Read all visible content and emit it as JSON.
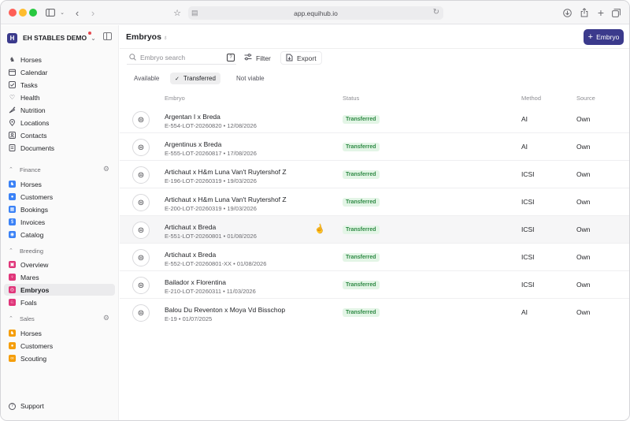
{
  "browser": {
    "url": "app.equihub.io"
  },
  "sidebar": {
    "org_name": "EH STABLES DEMO",
    "org_logo": "H",
    "main_items": [
      {
        "label": "Horses",
        "icon": "horse-icon"
      },
      {
        "label": "Calendar",
        "icon": "calendar-icon"
      },
      {
        "label": "Tasks",
        "icon": "tasks-icon"
      },
      {
        "label": "Health",
        "icon": "heart-icon"
      },
      {
        "label": "Nutrition",
        "icon": "carrot-icon"
      },
      {
        "label": "Locations",
        "icon": "location-icon"
      },
      {
        "label": "Contacts",
        "icon": "contacts-icon"
      },
      {
        "label": "Documents",
        "icon": "document-icon"
      }
    ],
    "finance": {
      "title": "Finance",
      "items": [
        {
          "label": "Horses"
        },
        {
          "label": "Customers"
        },
        {
          "label": "Bookings"
        },
        {
          "label": "Invoices"
        },
        {
          "label": "Catalog"
        }
      ]
    },
    "breeding": {
      "title": "Breeding",
      "items": [
        {
          "label": "Overview"
        },
        {
          "label": "Mares"
        },
        {
          "label": "Embryos"
        },
        {
          "label": "Foals"
        }
      ]
    },
    "sales": {
      "title": "Sales",
      "items": [
        {
          "label": "Horses"
        },
        {
          "label": "Customers"
        },
        {
          "label": "Scouting"
        }
      ]
    },
    "support_label": "Support"
  },
  "page": {
    "title": "Embryos",
    "primary_button": "Embryo",
    "search_placeholder": "Embryo search",
    "search_shortcut": "?",
    "filter_label": "Filter",
    "export_label": "Export",
    "tabs": [
      "Available",
      "Transferred",
      "Not viable"
    ],
    "active_tab": "Transferred"
  },
  "table": {
    "headers": {
      "embryo": "Embryo",
      "status": "Status",
      "method": "Method",
      "source": "Source"
    },
    "rows": [
      {
        "name": "Argentan I  x  Breda",
        "sub": "E-554-LOT-20260820 • 12/08/2026",
        "status": "Transferred",
        "method": "AI",
        "source": "Own"
      },
      {
        "name": "Argentinus  x  Breda",
        "sub": "E-555-LOT-20260817 • 17/08/2026",
        "status": "Transferred",
        "method": "AI",
        "source": "Own"
      },
      {
        "name": "Artichaut  x  H&m Luna Van't Ruytershof Z",
        "sub": "E-196-LOT-20260319 • 19/03/2026",
        "status": "Transferred",
        "method": "ICSI",
        "source": "Own"
      },
      {
        "name": "Artichaut  x  H&m Luna Van't Ruytershof Z",
        "sub": "E-200-LOT-20260319 • 19/03/2026",
        "status": "Transferred",
        "method": "ICSI",
        "source": "Own"
      },
      {
        "name": "Artichaut  x  Breda",
        "sub": "E-551-LOT-20260801 • 01/08/2026",
        "status": "Transferred",
        "method": "ICSI",
        "source": "Own"
      },
      {
        "name": "Artichaut  x  Breda",
        "sub": "E-552-LOT-20260801-XX • 01/08/2026",
        "status": "Transferred",
        "method": "ICSI",
        "source": "Own"
      },
      {
        "name": "Bailador  x  Florentina",
        "sub": "E-210-LOT-20260311 • 11/03/2026",
        "status": "Transferred",
        "method": "ICSI",
        "source": "Own"
      },
      {
        "name": "Balou Du Reventon  x  Moya Vd Bisschop",
        "sub": "E-19 • 01/07/2025",
        "status": "Transferred",
        "method": "AI",
        "source": "Own"
      }
    ]
  }
}
